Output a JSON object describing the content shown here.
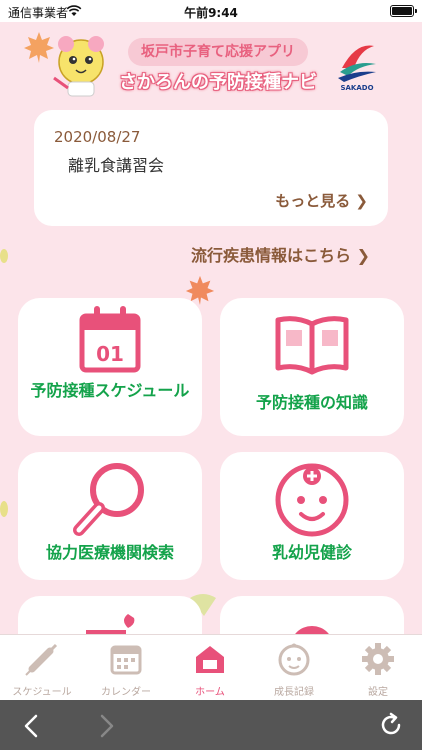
{
  "status_bar": {
    "carrier": "通信事業者",
    "time": "午前9:44"
  },
  "header": {
    "subtitle": "坂戸市子育て応援アプリ",
    "title": "さかろんの予防接種ナビ",
    "city_logo_text": "SAKADO"
  },
  "news": {
    "date": "2020/08/27",
    "title": "離乳食講習会",
    "more_label": "もっと見る ❯"
  },
  "disease_link": "流行疾患情報はこちら ❯",
  "tiles": [
    {
      "label": "予防接種スケジュール",
      "icon": "calendar-01-icon",
      "day": "01"
    },
    {
      "label": "予防接種の知識",
      "icon": "book-icon"
    },
    {
      "label": "協力医療機関検索",
      "icon": "magnifier-icon"
    },
    {
      "label": "乳幼児健診",
      "icon": "baby-doctor-icon"
    }
  ],
  "tabs": [
    {
      "label": "スケジュール",
      "icon": "syringe-icon",
      "active": false
    },
    {
      "label": "カレンダー",
      "icon": "calendar-icon",
      "active": false
    },
    {
      "label": "ホーム",
      "icon": "home-icon",
      "active": true
    },
    {
      "label": "成長記録",
      "icon": "baby-face-icon",
      "active": false
    },
    {
      "label": "設定",
      "icon": "gear-icon",
      "active": false
    }
  ],
  "colors": {
    "background": "#fce4ea",
    "accent_pink": "#e8517a",
    "tile_label_green": "#14a34b",
    "link_brown": "#8a5a3a",
    "tab_inactive": "#b9a8a0"
  }
}
